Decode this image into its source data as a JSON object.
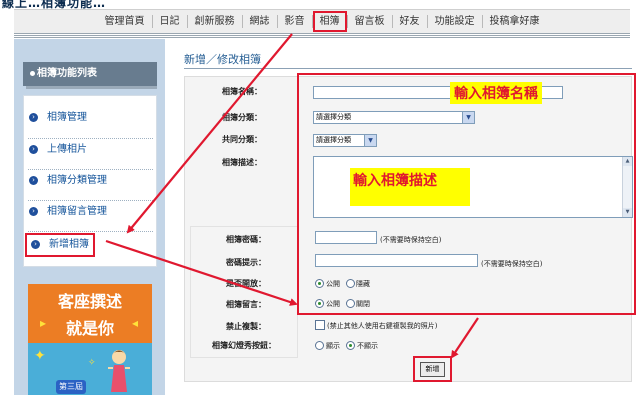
{
  "page_heading": "線上…相簿功能…",
  "nav": {
    "items": [
      "管理首頁",
      "日記",
      "創新服務",
      "網誌",
      "影音",
      "相簿",
      "留言板",
      "好友",
      "功能設定",
      "投稿拿好康"
    ],
    "active": "相簿"
  },
  "sidebar": {
    "title": "相簿功能列表",
    "items": [
      {
        "label": "相簿管理"
      },
      {
        "label": "上傳相片"
      },
      {
        "label": "相簿分類管理"
      },
      {
        "label": "相簿留言管理"
      },
      {
        "label": "新增相簿"
      }
    ],
    "highlighted": "新增相簿"
  },
  "ad": {
    "line1": "客座撰述",
    "line2": "就是你",
    "badge": "第三屆"
  },
  "main": {
    "title": "新增／修改相簿"
  },
  "form": {
    "album_name_label": "相簿名稱：",
    "album_category_label": "相簿分類：",
    "album_category_value": "請選擇分類",
    "shared_category_label": "共同分類：",
    "shared_category_value": "請選擇分類",
    "description_label": "相簿描述：",
    "password_label": "相簿密碼：",
    "password_hint": "(不需要時保持空白)",
    "password_tip_label": "密碼提示：",
    "password_tip_hint": "(不需要時保持空白)",
    "public_label": "是否開放：",
    "public_options": [
      "公開",
      "隱藏"
    ],
    "public_selected": "公開",
    "comments_label": "相簿留言：",
    "comments_options": [
      "公開",
      "關閉"
    ],
    "comments_selected": "公開",
    "copy_protect_label": "禁止複製：",
    "copy_protect_text": "(禁止其他人使用右鍵複製我的照片)",
    "copy_protect_checked": false,
    "slideshow_label": "相簿幻燈秀按鈕：",
    "slideshow_options": [
      "顯示",
      "不顯示"
    ],
    "slideshow_selected": "不顯示",
    "submit_label": "新增"
  },
  "annotations": {
    "name_callout": "輸入相簿名稱",
    "desc_callout": "輸入相簿描述"
  },
  "colors": {
    "accent_red": "#e0182f",
    "callout_yellow": "#ffff00",
    "sidebar_bg": "#c3d5e7",
    "link_blue": "#14549a"
  }
}
